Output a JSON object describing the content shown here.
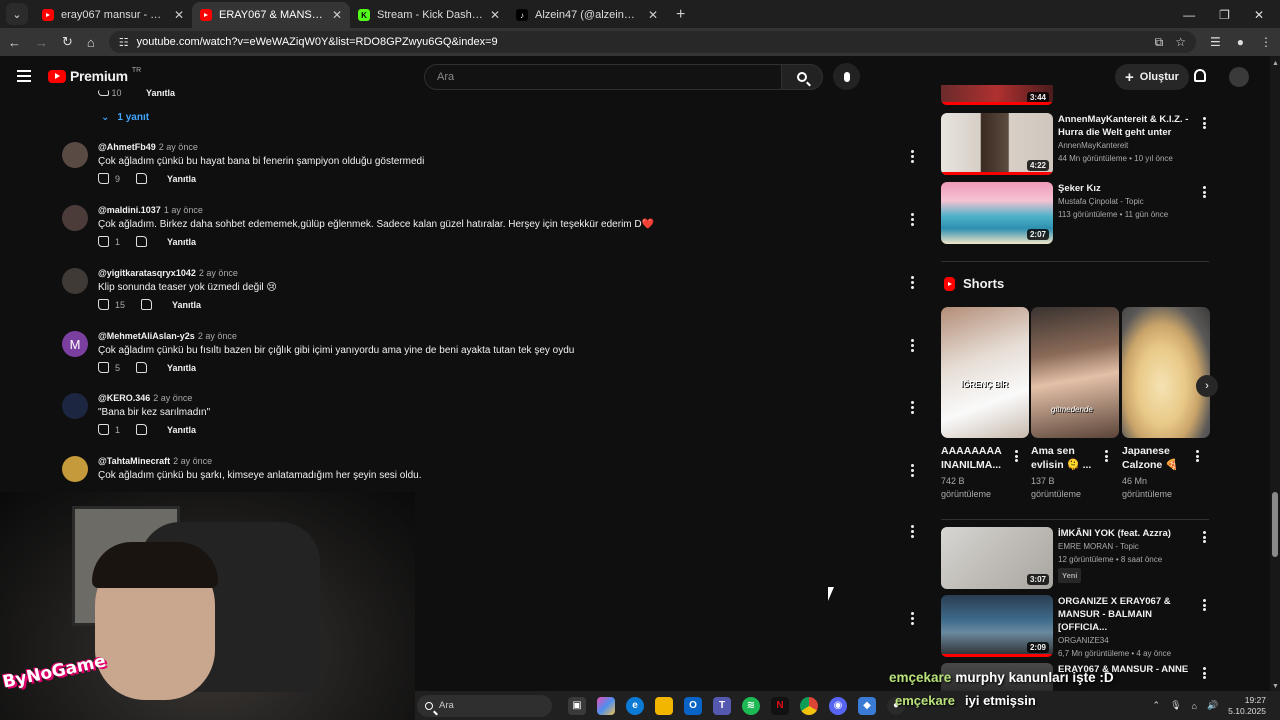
{
  "browser": {
    "tabs": [
      {
        "label": "eray067 mansur - YouTube",
        "favicon": "youtube-icon",
        "active": false
      },
      {
        "label": "ERAY067 & MANSUR - ÇOK AĞLADIM",
        "favicon": "youtube-icon",
        "active": true
      },
      {
        "label": "Stream - Kick Dashboard",
        "favicon": "kick-icon",
        "active": false
      },
      {
        "label": "Alzein47 (@alzein4735) | TikTok",
        "favicon": "tiktok-icon",
        "active": false
      }
    ],
    "url": "youtube.com/watch?v=eWeWAZiqW0Y&list=RDO8GPZwyu6GQ&index=9"
  },
  "yt_header": {
    "logo_text": "Premium",
    "region": "TR",
    "search_placeholder": "Ara",
    "create_label": "Oluştur"
  },
  "comments": {
    "prev_reply_label": "Yanıtla",
    "prev_like_count": "10",
    "replies_toggle": "1 yanıt",
    "items": [
      {
        "user": "@AhmetFb49",
        "time": "2 ay önce",
        "text": "Çok ağladım çünkü bu hayat bana bi fenerin şampiyon olduğu göstermedi",
        "likes": "9",
        "reply": "Yanıtla",
        "avatar": ""
      },
      {
        "user": "@maldini.1037",
        "time": "1 ay önce",
        "text": "Çok ağladım. Birkez daha sohbet edememek,gülüp eğlenmek. Sadece kalan güzel hatıralar. Herşey için teşekkür ederim D❤️",
        "likes": "1",
        "reply": "Yanıtla",
        "avatar": ""
      },
      {
        "user": "@yigitkaratasqryx1042",
        "time": "2 ay önce",
        "text": "Klip sonunda teaser yok üzmedi değil 😢",
        "likes": "15",
        "reply": "Yanıtla",
        "avatar": ""
      },
      {
        "user": "@MehmetAliAslan-y2s",
        "time": "2 ay önce",
        "text": "Çok ağladım çünkü bu fısıltı bazen bir çığlık gibi içimi yanıyordu ama yine de beni ayakta tutan tek şey oydu",
        "likes": "5",
        "reply": "Yanıtla",
        "avatar": "M"
      },
      {
        "user": "@KERO.346",
        "time": "2 ay önce",
        "text": "\"Bana bir kez sarılmadın\"",
        "likes": "1",
        "reply": "Yanıtla",
        "avatar": ""
      },
      {
        "user": "@TahtaMinecraft",
        "time": "2 ay önce",
        "text": "Çok ağladım çünkü bu şarkı, kimseye anlatamadığım her şeyin sesi oldu.",
        "likes": "",
        "reply": "",
        "avatar": ""
      }
    ]
  },
  "webcam": {
    "overlay_tag": "ByNoGame"
  },
  "sidebar": {
    "videos_top": [
      {
        "title": "",
        "channel": "",
        "meta": "",
        "duration": "3:44",
        "badge": ""
      },
      {
        "title": "AnnenMayKantereit & K.I.Z. - Hurra die Welt geht unter",
        "channel": "AnnenMayKantereit",
        "meta": "44 Mn görüntüleme • 10 yıl önce",
        "duration": "4:22",
        "badge": ""
      },
      {
        "title": "Şeker Kız",
        "channel": "Mustafa Çinpolat - Topic",
        "meta": "113 görüntüleme • 11 gün önce",
        "duration": "2:07",
        "badge": ""
      }
    ],
    "shorts_label": "Shorts",
    "shorts": [
      {
        "title": "AAAAAAAA INANILMA...",
        "views": "742 B görüntüleme",
        "thumb_text": "İĞRENÇ BİR"
      },
      {
        "title": "Ama sen evlisin 🫠 ...",
        "views": "137 B görüntüleme",
        "thumb_text": "gitmedende"
      },
      {
        "title": "Japanese Calzone 🍕",
        "views": "46 Mn görüntüleme",
        "thumb_text": ""
      }
    ],
    "videos_bottom": [
      {
        "title": "İMKÂNI YOK (feat. Azzra)",
        "channel": "EMRE MORAN - Topic",
        "meta": "12 görüntüleme • 8 saat önce",
        "duration": "3:07",
        "badge": "Yeni"
      },
      {
        "title": "ORGANIZE X ERAY067 & MANSUR - BALMAIN [OFFICIA...",
        "channel": "ORGANIZE34",
        "meta": "6,7 Mn görüntüleme • 4 ay önce",
        "duration": "2:09",
        "badge": ""
      },
      {
        "title": "ERAY067 & MANSUR - ANNE",
        "channel": "",
        "meta": "",
        "duration": "",
        "badge": ""
      }
    ]
  },
  "chat": [
    {
      "user": "emçekare",
      "msg": "murphy kanunları işte :D"
    },
    {
      "user": "emçekare",
      "msg": "iyi etmişsin"
    }
  ],
  "taskbar": {
    "search_placeholder": "Ara",
    "time": "19:27",
    "date": "5.10.2025"
  }
}
